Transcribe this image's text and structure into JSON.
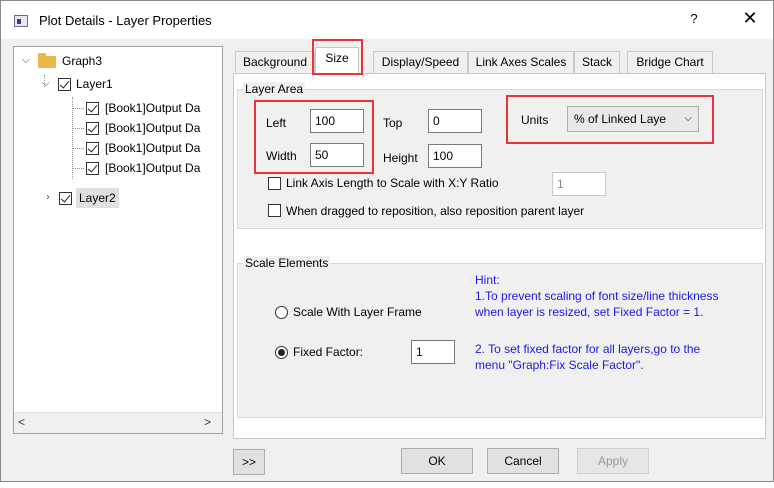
{
  "window": {
    "title": "Plot Details - Layer Properties",
    "help_label": "?",
    "close_label": "✕"
  },
  "tree": {
    "root": {
      "label": "Graph3",
      "expanded": true
    },
    "layer1": {
      "label": "Layer1",
      "checked": true
    },
    "datasets": [
      {
        "label": "[Book1]Output Da",
        "checked": true
      },
      {
        "label": "[Book1]Output Da",
        "checked": true
      },
      {
        "label": "[Book1]Output Da",
        "checked": true
      },
      {
        "label": "[Book1]Output Da",
        "checked": true
      }
    ],
    "layer2": {
      "label": "Layer2",
      "checked": true,
      "selected": true
    },
    "scroll_left": "<",
    "scroll_right": ">"
  },
  "tabs": [
    {
      "label": "Background",
      "active": false
    },
    {
      "label": "Size",
      "active": true
    },
    {
      "label": "Display/Speed",
      "active": false
    },
    {
      "label": "Link Axes Scales",
      "active": false
    },
    {
      "label": "Stack",
      "active": false
    },
    {
      "label": "Bridge Chart",
      "active": false
    }
  ],
  "layer_area": {
    "group_label": "Layer Area",
    "left_label": "Left",
    "left_value": "100",
    "top_label": "Top",
    "top_value": "0",
    "width_label": "Width",
    "width_value": "50",
    "height_label": "Height",
    "height_value": "100",
    "units_label": "Units",
    "units_value": "% of Linked Laye",
    "link_axis_label": "Link Axis Length to Scale with X:Y Ratio",
    "link_axis_checked": false,
    "ratio_value": "1",
    "reposition_label": "When dragged to reposition, also reposition parent layer",
    "reposition_checked": false
  },
  "scale_elements": {
    "group_label": "Scale Elements",
    "option_frame": "Scale With Layer Frame",
    "option_fixed": "Fixed Factor:",
    "selected": "fixed",
    "fixed_value": "1",
    "hint_title": "Hint:",
    "hint_line1": "1.To prevent scaling of font size/line thickness",
    "hint_line2": "when layer is resized, set Fixed Factor = 1.",
    "hint_line3": "2. To set fixed factor for all layers,go to the",
    "hint_line4": "menu \"Graph:Fix Scale Factor\"."
  },
  "buttons": {
    "expand": ">>",
    "ok": "OK",
    "cancel": "Cancel",
    "apply": "Apply"
  },
  "colors": {
    "highlight": "#e8333a",
    "hint_text": "#1a1ae6",
    "dialog_bg": "#f0f0f0"
  }
}
